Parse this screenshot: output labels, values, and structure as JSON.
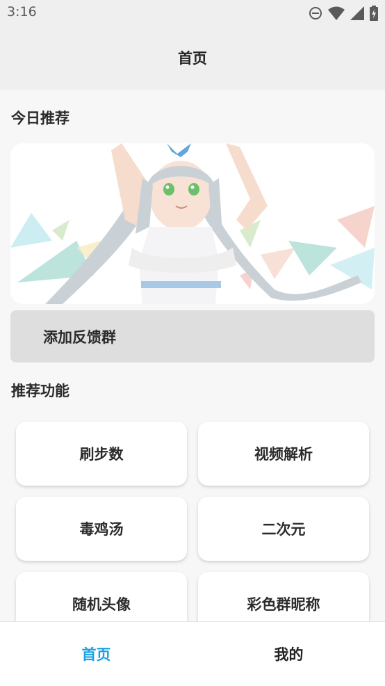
{
  "status_bar": {
    "time": "3:16"
  },
  "app_bar": {
    "title": "首页"
  },
  "sections": {
    "today": "今日推荐",
    "features": "推荐功能"
  },
  "feedback": {
    "label": "添加反馈群"
  },
  "features": [
    {
      "label": "刷步数"
    },
    {
      "label": "视频解析"
    },
    {
      "label": "毒鸡汤"
    },
    {
      "label": "二次元"
    },
    {
      "label": "随机头像"
    },
    {
      "label": "彩色群昵称"
    }
  ],
  "bottom_nav": {
    "items": [
      {
        "label": "首页",
        "active": true
      },
      {
        "label": "我的",
        "active": false
      }
    ]
  },
  "colors": {
    "active_tab": "#1ba1e2",
    "inactive_tab": "#222222"
  },
  "icons": [
    "dnd-icon",
    "wifi-icon",
    "cell-signal-icon",
    "battery-charging-icon"
  ]
}
